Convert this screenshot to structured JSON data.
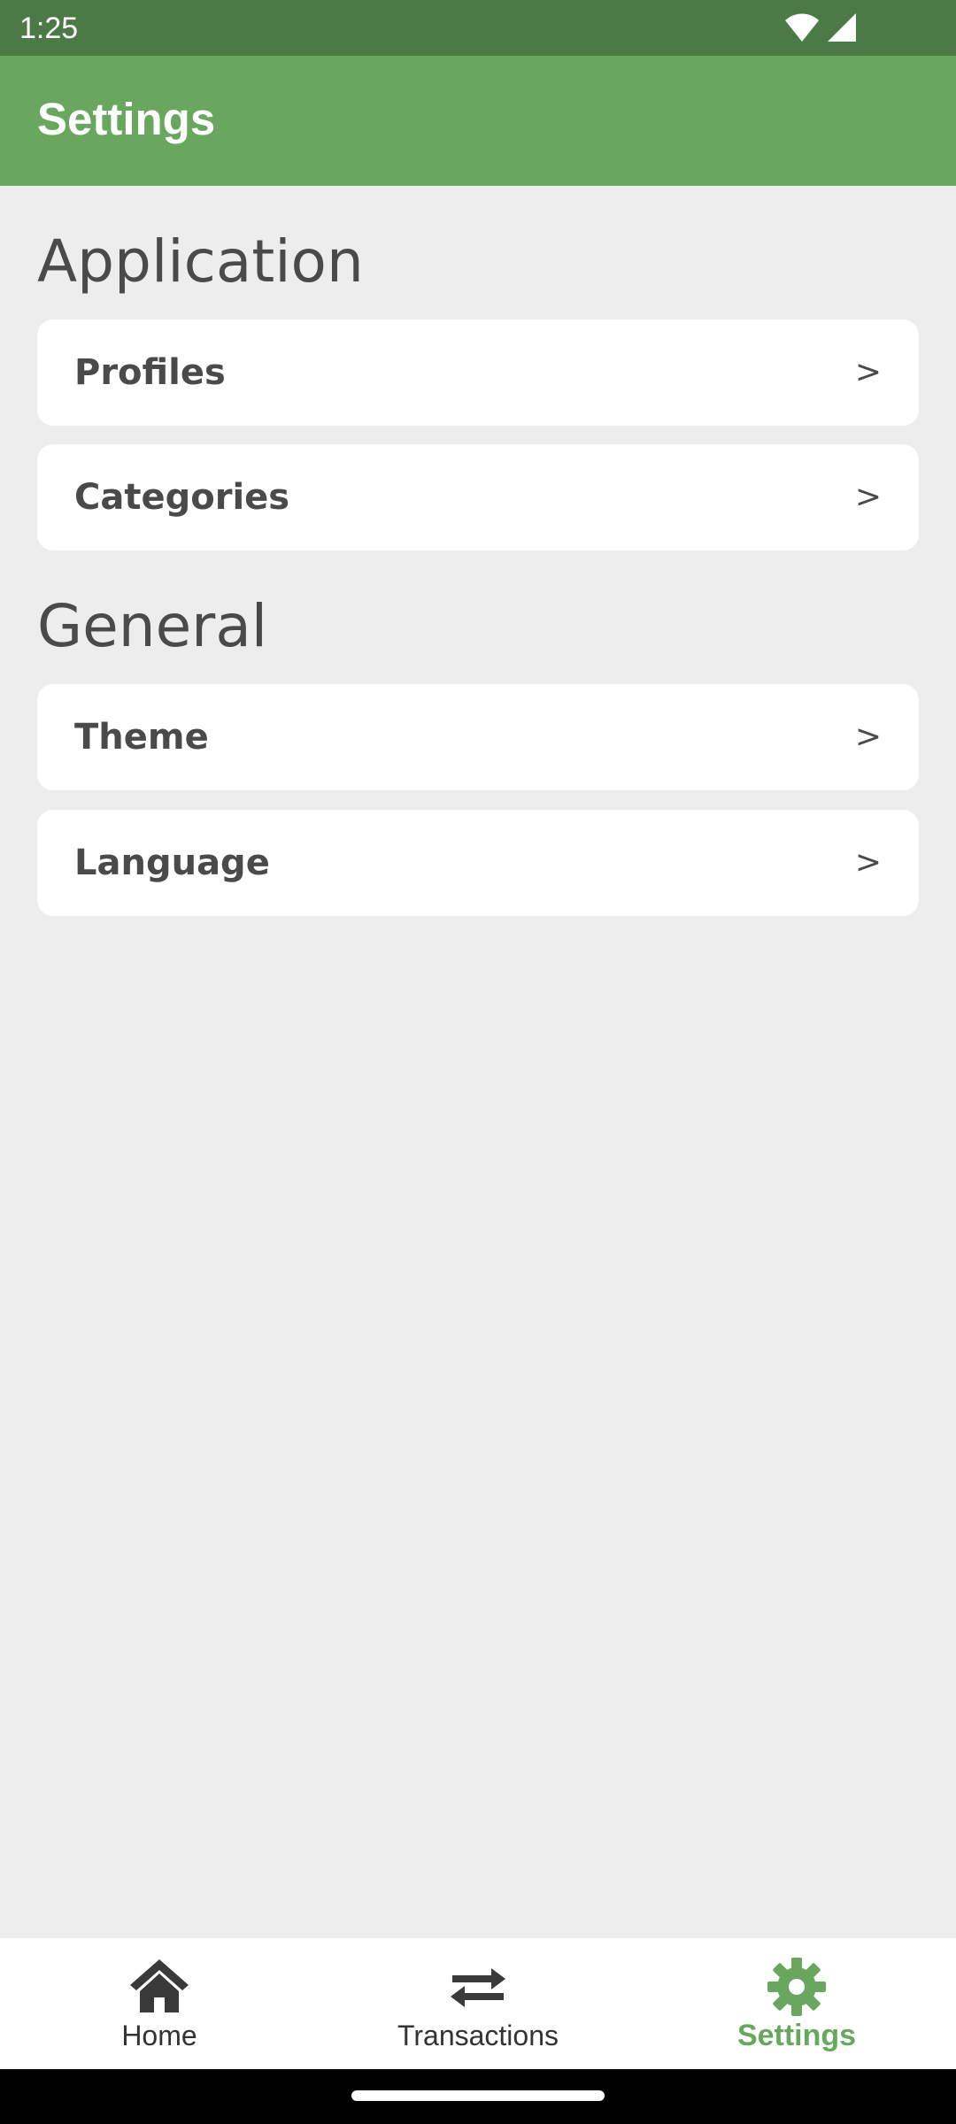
{
  "status_bar": {
    "time": "1:25"
  },
  "app_bar": {
    "title": "Settings"
  },
  "sections": [
    {
      "title": "Application",
      "items": [
        {
          "label": "Profiles",
          "chevron": ">"
        },
        {
          "label": "Categories",
          "chevron": ">"
        }
      ]
    },
    {
      "title": "General",
      "items": [
        {
          "label": "Theme",
          "chevron": ">"
        },
        {
          "label": "Language",
          "chevron": ">"
        }
      ]
    }
  ],
  "bottom_nav": {
    "items": [
      {
        "label": "Home",
        "icon": "home-icon",
        "active": false
      },
      {
        "label": "Transactions",
        "icon": "swap-arrows-icon",
        "active": false
      },
      {
        "label": "Settings",
        "icon": "gear-icon",
        "active": true
      }
    ]
  },
  "colors": {
    "status_bar": "#4b7a47",
    "app_bar": "#69a75f",
    "accent": "#69a75f",
    "background": "#ededed",
    "text": "#4a4a4a"
  }
}
